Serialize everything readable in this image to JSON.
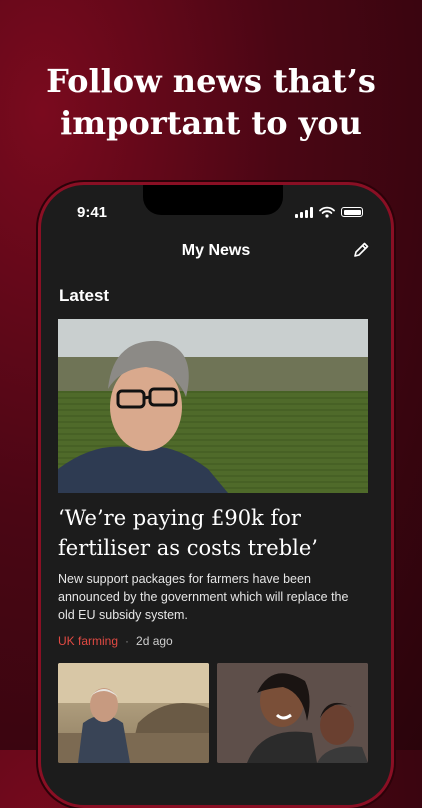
{
  "promo": {
    "headline_line1": "Follow news that’s",
    "headline_line2": "important to you"
  },
  "status_bar": {
    "time": "9:41"
  },
  "nav": {
    "title": "My News"
  },
  "section": {
    "title": "Latest"
  },
  "article": {
    "title": "‘We’re paying £90k for fertiliser as costs treble’",
    "summary": "New support packages for farmers have been announced by the government which will replace the old EU subsidy system.",
    "topic": "UK farming",
    "age": "2d ago"
  },
  "colors": {
    "brand": "#7a0a1e",
    "topic": "#e14a43"
  }
}
